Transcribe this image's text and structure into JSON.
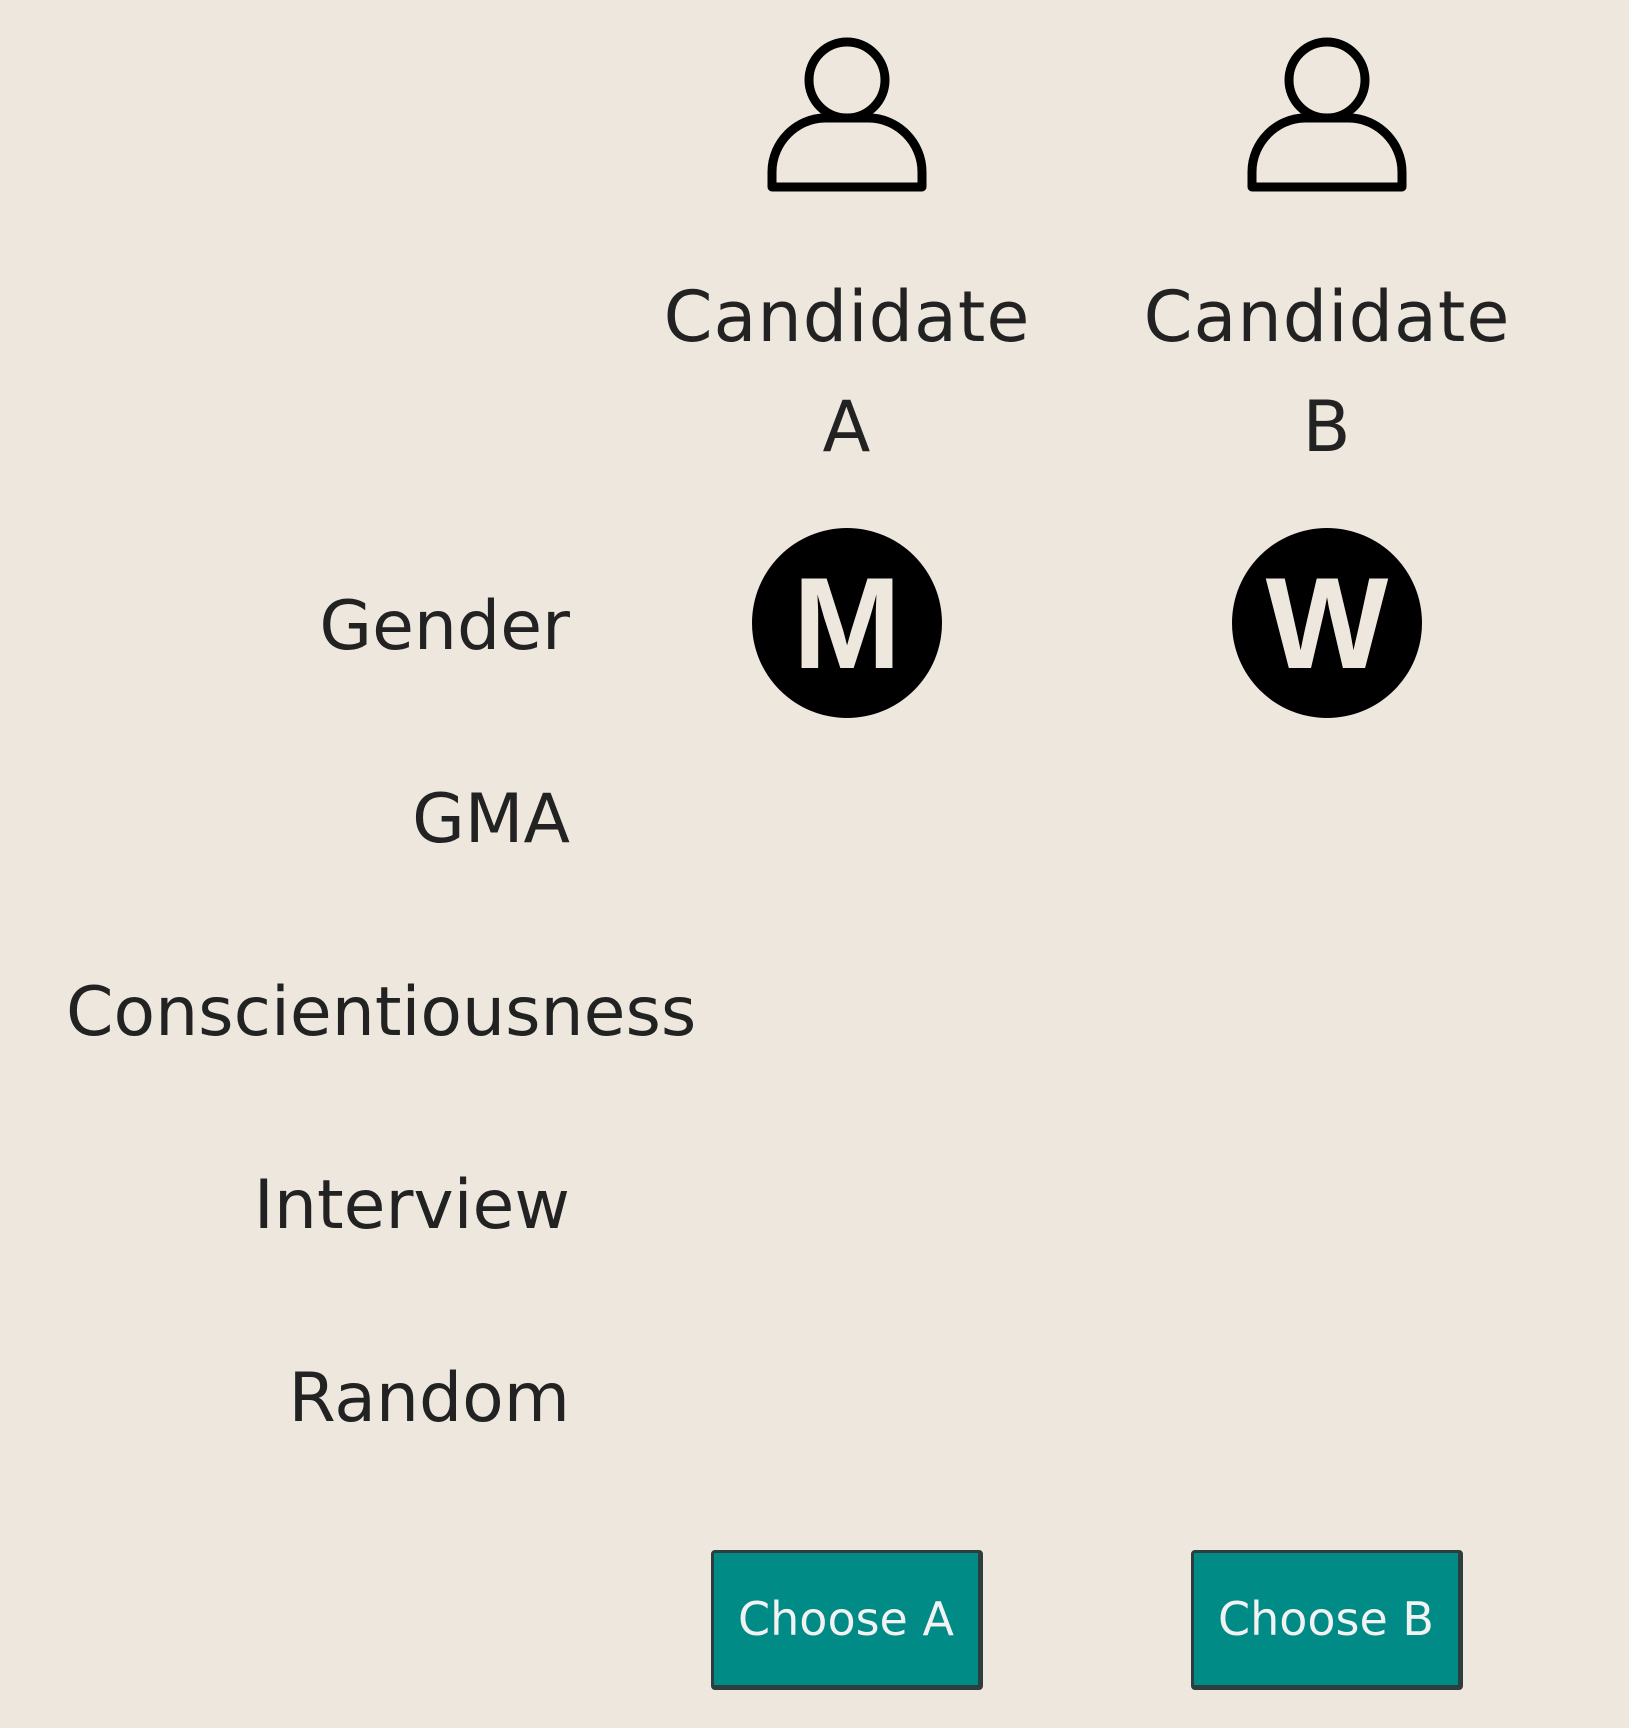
{
  "candidates": [
    {
      "name_line1": "Candidate",
      "name_line2": "A",
      "gender": "M",
      "button_label": "Choose A",
      "icon": "person-outline-icon"
    },
    {
      "name_line1": "Candidate",
      "name_line2": "B",
      "gender": "W",
      "button_label": "Choose B",
      "icon": "person-outline-icon"
    }
  ],
  "attributes": [
    "Gender",
    "GMA",
    "Conscientiousness",
    "Interview",
    "Random"
  ],
  "colors": {
    "background": "#ede7de",
    "button": "#008b87",
    "badge": "#000000",
    "badge_text": "#ede7de",
    "text": "#222222"
  }
}
